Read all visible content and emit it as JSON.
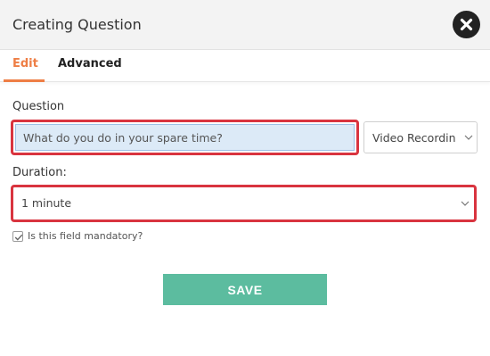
{
  "dialog": {
    "title": "Creating Question"
  },
  "tabs": [
    {
      "label": "Edit",
      "active": true
    },
    {
      "label": "Advanced",
      "active": false
    }
  ],
  "question": {
    "label": "Question",
    "value": "What do you do in your spare time?",
    "type_selected": "Video Recording"
  },
  "duration": {
    "label": "Duration:",
    "selected": "1 minute"
  },
  "mandatory": {
    "label": "Is this field mandatory?",
    "checked": true
  },
  "save_label": "SAVE",
  "colors": {
    "accent": "#ee7e45",
    "save_button": "#5cbc9f",
    "highlight_border": "#d9343f",
    "input_bg": "#dceaf7"
  },
  "icons": {
    "close": "close-icon",
    "chevron": "chevron-down-icon",
    "check": "check-icon"
  }
}
